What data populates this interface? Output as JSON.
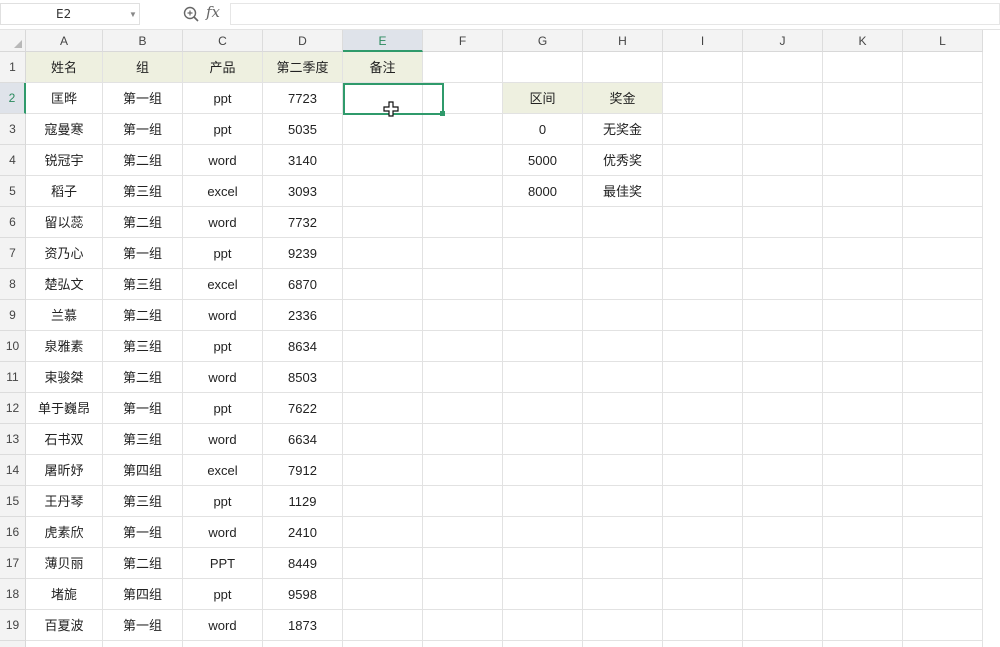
{
  "formula_bar": {
    "cell_ref": "E2",
    "fx_label": "fx",
    "formula": ""
  },
  "columns": [
    "A",
    "B",
    "C",
    "D",
    "E",
    "F",
    "G",
    "H",
    "I",
    "J",
    "K",
    "L"
  ],
  "selected": {
    "column": "E",
    "row": 2
  },
  "table": {
    "headers": [
      "姓名",
      "组",
      "产品",
      "第二季度",
      "备注"
    ],
    "rows": [
      [
        "匡晔",
        "第一组",
        "ppt",
        "7723",
        ""
      ],
      [
        "寇曼寒",
        "第一组",
        "ppt",
        "5035",
        ""
      ],
      [
        "锐冠宇",
        "第二组",
        "word",
        "3140",
        ""
      ],
      [
        "稻子",
        "第三组",
        "excel",
        "3093",
        ""
      ],
      [
        "留以蕊",
        "第二组",
        "word",
        "7732",
        ""
      ],
      [
        "资乃心",
        "第一组",
        "ppt",
        "9239",
        ""
      ],
      [
        "楚弘文",
        "第三组",
        "excel",
        "6870",
        ""
      ],
      [
        "兰慕",
        "第二组",
        "word",
        "2336",
        ""
      ],
      [
        "泉雅素",
        "第三组",
        "ppt",
        "8634",
        ""
      ],
      [
        "束骏桀",
        "第二组",
        "word",
        "8503",
        ""
      ],
      [
        "单于巍昂",
        "第一组",
        "ppt",
        "7622",
        ""
      ],
      [
        "石书双",
        "第三组",
        "word",
        "6634",
        ""
      ],
      [
        "屠昕妤",
        "第四组",
        "excel",
        "7912",
        ""
      ],
      [
        "王丹琴",
        "第三组",
        "ppt",
        "1129",
        ""
      ],
      [
        "虎素欣",
        "第一组",
        "word",
        "2410",
        ""
      ],
      [
        "薄贝丽",
        "第二组",
        "PPT",
        "8449",
        ""
      ],
      [
        "堵旎",
        "第四组",
        "ppt",
        "9598",
        ""
      ],
      [
        "百夏波",
        "第一组",
        "word",
        "1873",
        ""
      ]
    ]
  },
  "bonus_table": {
    "headers": [
      "区间",
      "奖金"
    ],
    "rows": [
      [
        "0",
        "无奖金"
      ],
      [
        "5000",
        "优秀奖"
      ],
      [
        "8000",
        "最佳奖"
      ]
    ]
  },
  "colors": {
    "header_fill": "#eef0e0",
    "selection": "#2f9a6b"
  },
  "icons": [
    "zoom-icon",
    "select-all-icon",
    "move-cursor-icon",
    "dropdown-caret-icon"
  ]
}
